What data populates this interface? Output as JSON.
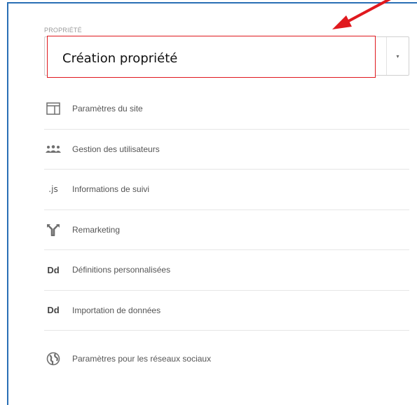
{
  "section": {
    "label": "PROPRIÉTÉ"
  },
  "property_select": {
    "value": "Création propriété",
    "arrow_glyph": "▾"
  },
  "annotation": {
    "text": "Création propriété",
    "color": "#e0191e"
  },
  "menu": {
    "items": [
      {
        "label": "Paramètres du site",
        "icon": "layout-icon"
      },
      {
        "label": "Gestion des utilisateurs",
        "icon": "users-icon"
      },
      {
        "label": "Informations de suivi",
        "icon": "js-icon",
        "icon_text": ".js"
      },
      {
        "label": "Remarketing",
        "icon": "remarketing-icon"
      },
      {
        "label": "Définitions personnalisées",
        "icon": "dd-icon",
        "icon_text": "Dd"
      },
      {
        "label": "Importation de données",
        "icon": "dd-icon",
        "icon_text": "Dd"
      },
      {
        "label": "Paramètres pour les réseaux sociaux",
        "icon": "globe-icon"
      }
    ]
  },
  "colors": {
    "frame_border": "#2a6fb5",
    "annotation_red": "#e0191e",
    "icon_gray": "#666666",
    "text_gray": "#555555",
    "divider": "#e6e6e6"
  }
}
